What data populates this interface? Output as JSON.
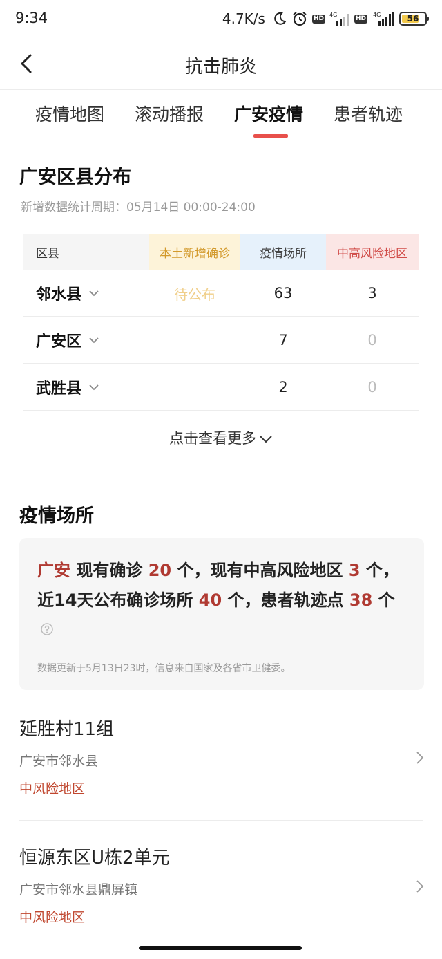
{
  "status_bar": {
    "time": "9:34",
    "speed": "4.7K/s",
    "battery": "56",
    "icons": [
      "moon-icon",
      "alarm-icon",
      "hd-icon",
      "signal-4g-icon",
      "hd-icon",
      "signal-4g-icon",
      "battery-icon"
    ]
  },
  "header": {
    "title": "抗击肺炎"
  },
  "tabs": [
    {
      "label": "疫情地图"
    },
    {
      "label": "滚动播报"
    },
    {
      "label": "广安疫情",
      "active": true
    },
    {
      "label": "患者轨迹"
    }
  ],
  "district": {
    "title": "广安区县分布",
    "period": "新增数据统计周期：05月14日 00:00-24:00",
    "columns": {
      "county": "区县",
      "new_local": "本土新增确诊",
      "venues": "疫情场所",
      "risk_areas": "中高风险地区"
    },
    "rows": [
      {
        "county": "邻水县",
        "new_local": "待公布",
        "venues": "63",
        "risk_areas": "3"
      },
      {
        "county": "广安区",
        "new_local": "",
        "venues": "7",
        "risk_areas": "0"
      },
      {
        "county": "武胜县",
        "new_local": "",
        "venues": "2",
        "risk_areas": "0"
      }
    ],
    "more": "点击查看更多"
  },
  "venues": {
    "title": "疫情场所",
    "summary": {
      "city": "广安",
      "t1": " 现有确诊 ",
      "confirmed": "20",
      "t2": " 个，现有中高风险地区 ",
      "risk_areas": "3",
      "t3": " 个，近14天公布确诊场所 ",
      "venues": "40",
      "t4": " 个，患者轨迹点 ",
      "track_points": "38",
      "t5": " 个"
    },
    "note": "数据更新于5月13日23时，信息来自国家及各省市卫健委。",
    "places": [
      {
        "name": "延胜村11组",
        "address": "广安市邻水县",
        "risk": "中风险地区"
      },
      {
        "name": "恒源东区U栋2单元",
        "address": "广安市邻水县鼎屏镇",
        "risk": "中风险地区"
      }
    ]
  },
  "colors": {
    "accent": "#e8504b",
    "highlight": "#b03a32",
    "risk": "#c0472f"
  }
}
